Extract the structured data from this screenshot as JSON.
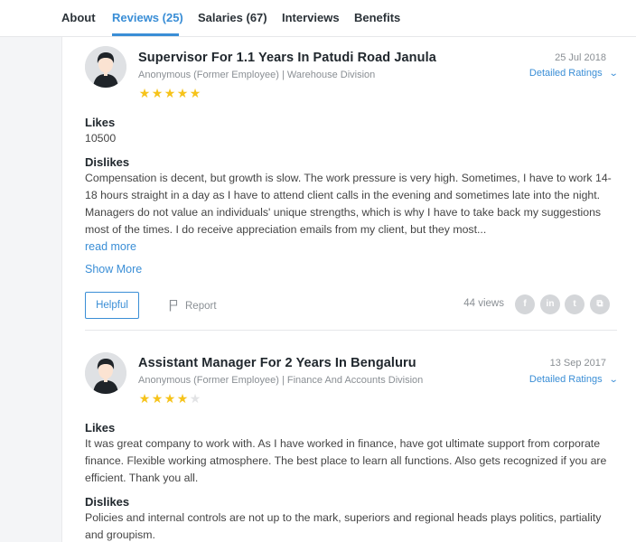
{
  "tabs": [
    {
      "label": "About"
    },
    {
      "label": "Reviews (25)"
    },
    {
      "label": "Salaries (67)"
    },
    {
      "label": "Interviews"
    },
    {
      "label": "Benefits"
    }
  ],
  "reviews": [
    {
      "title": "Supervisor For 1.1 Years In Patudi Road Janula",
      "meta": "Anonymous (Former Employee) | Warehouse Division",
      "rating": 5,
      "date": "25 Jul 2018",
      "detailed_ratings": "Detailed Ratings",
      "likes_heading": "Likes",
      "likes": "10500",
      "dislikes_heading": "Dislikes",
      "dislikes": "Compensation is decent, but growth is slow. The work pressure is very high. Sometimes, I have to work 14-18 hours straight in a day as I have to attend client calls in the evening and sometimes late into the night. Managers do not value an individuals' unique strengths, which is why I have to take back my suggestions most of the times. I do receive appreciation emails from my client, but they most...",
      "read_more": "read more",
      "show_more": "Show More",
      "helpful": "Helpful",
      "report": "Report",
      "views": "44 views"
    },
    {
      "title": "Assistant Manager For 2 Years In Bengaluru",
      "meta": "Anonymous (Former Employee) | Finance And Accounts Division",
      "rating": 4,
      "date": "13 Sep 2017",
      "detailed_ratings": "Detailed Ratings",
      "likes_heading": "Likes",
      "likes": "It was great company to work with. As I have worked in finance, have got ultimate support from corporate finance. Flexible working atmosphere. The best place to learn all functions. Also gets recognized if you are efficient. Thank you all.",
      "dislikes_heading": "Dislikes",
      "dislikes": "Policies and internal controls are not up to the mark, superiors and regional heads plays politics, partiality and groupism."
    }
  ],
  "social": [
    {
      "icon": "facebook-icon",
      "glyph": "f"
    },
    {
      "icon": "linkedin-icon",
      "glyph": "in"
    },
    {
      "icon": "twitter-icon",
      "glyph": "t"
    },
    {
      "icon": "share-icon",
      "glyph": "⧉"
    }
  ],
  "colors": {
    "accent": "#3a8ed6",
    "star": "#f6c31a",
    "star_off": "#e2e3e5",
    "title": "#20272d",
    "muted": "#8a8f94"
  }
}
